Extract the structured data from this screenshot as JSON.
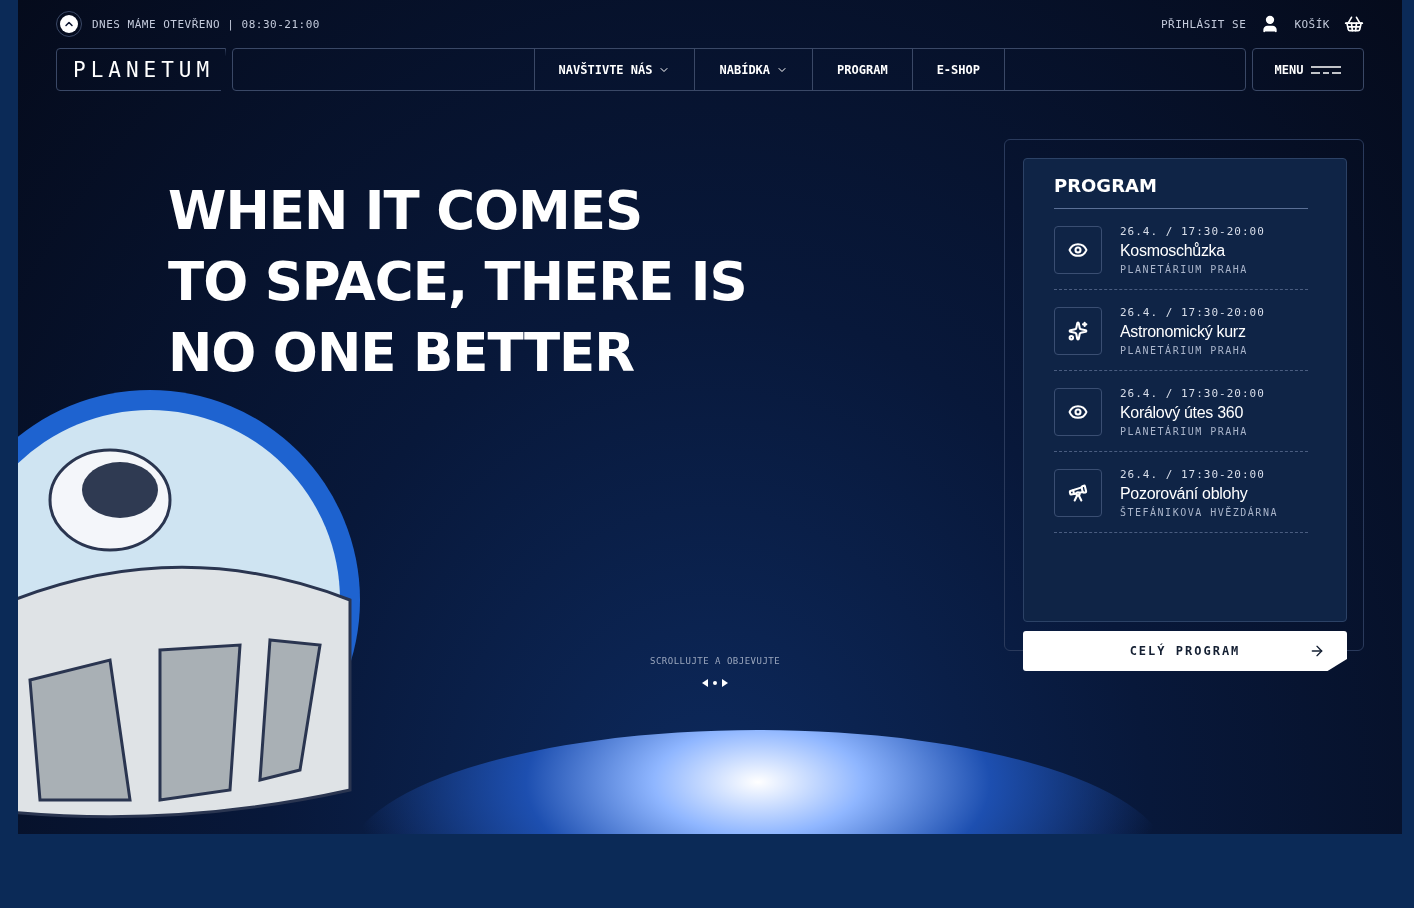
{
  "topbar": {
    "open_status": "DNES MÁME OTEVŘENO | 08:30-21:00",
    "login": "PŘIHLÁSIT SE",
    "cart": "KOŠÍK"
  },
  "nav": {
    "logo": "PLANETUM",
    "items": [
      {
        "label": "NAVŠTIVTE NÁS",
        "dropdown": true
      },
      {
        "label": "NABÍDKA",
        "dropdown": true
      },
      {
        "label": "PROGRAM",
        "dropdown": false
      },
      {
        "label": "E-SHOP",
        "dropdown": false
      }
    ],
    "menu": "MENU"
  },
  "hero": {
    "lines": [
      "WHEN IT COMES",
      "TO SPACE, THERE IS",
      "NO ONE BETTER"
    ],
    "scroll_hint": "SCROLLUJTE A OBJEVUJTE"
  },
  "program": {
    "title": "PROGRAM",
    "events": [
      {
        "kind": "eye",
        "when": "26.4. / 17:30-20:00",
        "name": "Kosmoschůzka",
        "place": "PLANETÁRIUM PRAHA"
      },
      {
        "kind": "sparkle",
        "when": "26.4. / 17:30-20:00",
        "name": "Astronomický kurz",
        "place": "PLANETÁRIUM PRAHA"
      },
      {
        "kind": "eye",
        "when": "26.4. / 17:30-20:00",
        "name": "Korálový útes 360",
        "place": "PLANETÁRIUM PRAHA"
      },
      {
        "kind": "telescope",
        "when": "26.4. / 17:30-20:00",
        "name": "Pozorování oblohy",
        "place": "ŠTEFÁNIKOVA HVĚZDÁRNA"
      }
    ],
    "button": "CELÝ PROGRAM"
  }
}
